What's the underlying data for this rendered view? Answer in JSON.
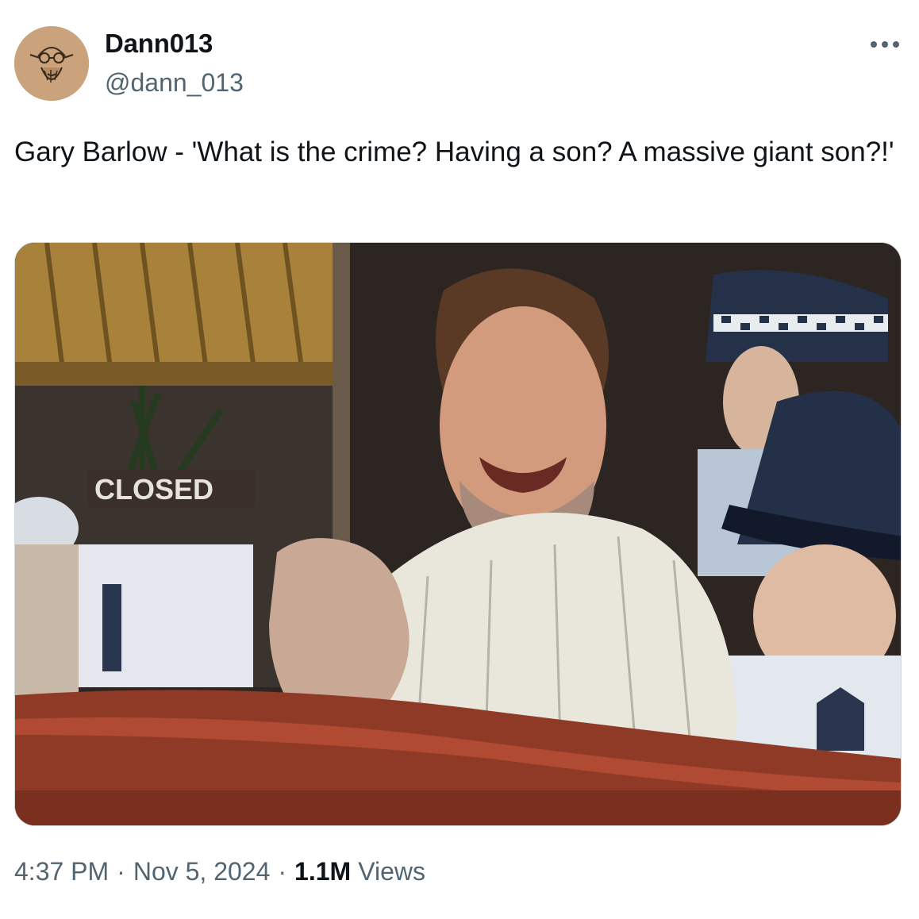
{
  "author": {
    "display_name": "Dann013",
    "handle": "@dann_013",
    "avatar_icon": "sketch-face-avatar"
  },
  "tweet": {
    "text": "Gary Barlow - 'What is the crime? Having a son? A massive giant son?!'",
    "more_icon": "more-dots-icon"
  },
  "media": {
    "sign_text": "CLOSED"
  },
  "meta": {
    "time": "4:37 PM",
    "date": "Nov 5, 2024",
    "separator": "·",
    "views_count": "1.1M",
    "views_label": "Views"
  },
  "colors": {
    "primary_text": "#0f1419",
    "secondary_text": "#536471",
    "border": "#cfd9de"
  }
}
